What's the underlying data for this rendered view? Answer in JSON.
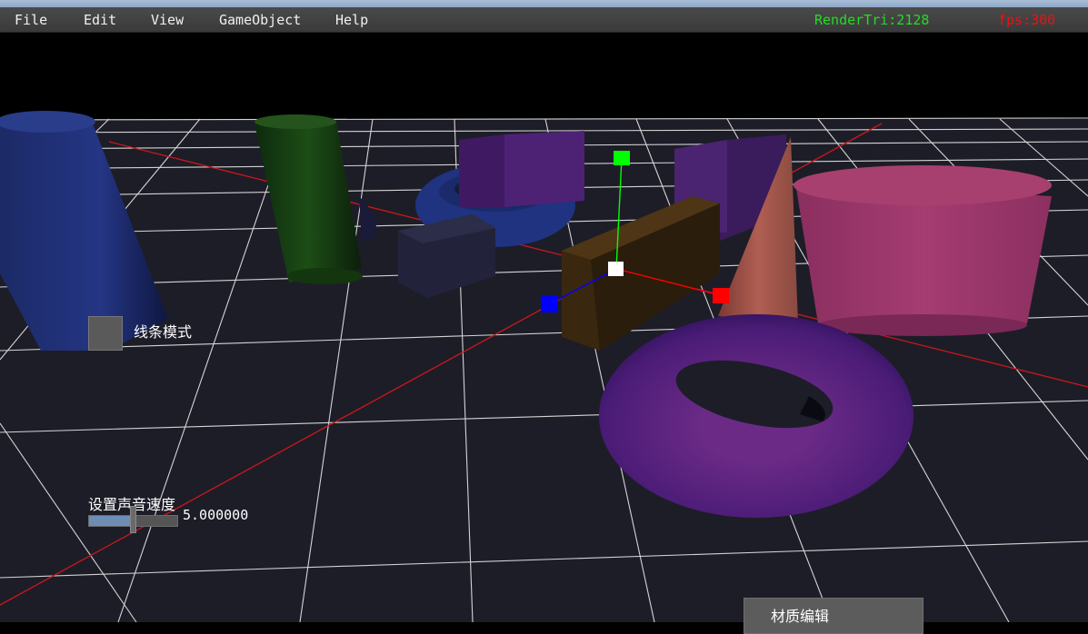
{
  "menu": {
    "items": [
      {
        "label": "File"
      },
      {
        "label": "Edit"
      },
      {
        "label": "View"
      },
      {
        "label": "GameObject"
      },
      {
        "label": "Help"
      }
    ]
  },
  "stats": {
    "render_tri": "RenderTri:2128",
    "fps": "fps:300",
    "render_tri_color": "#22dd22",
    "fps_color": "#ee1111"
  },
  "ui": {
    "wireframe_label": "线条模式",
    "sound_speed_label": "设置声音速度",
    "sound_speed_value": "5.000000",
    "sound_speed_fraction": 0.5,
    "material_edit_label": "材质编辑"
  },
  "gizmo": {
    "x_axis_color": "#ff0000",
    "y_axis_color": "#00ff00",
    "z_axis_color": "#0000ff"
  }
}
